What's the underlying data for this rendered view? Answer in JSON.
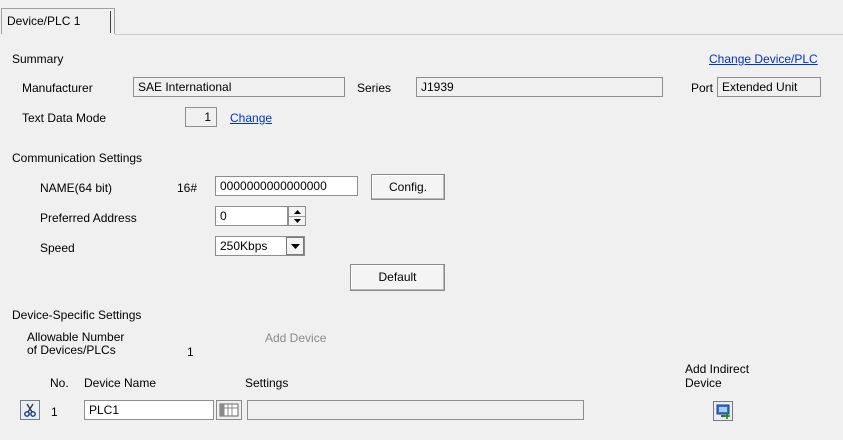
{
  "tab": {
    "label": "Device/PLC 1"
  },
  "summary": {
    "heading": "Summary",
    "change_device_link": "Change Device/PLC",
    "manufacturer_label": "Manufacturer",
    "manufacturer_value": "SAE International",
    "series_label": "Series",
    "series_value": "J1939",
    "port_label": "Port",
    "port_value": "Extended Unit",
    "text_data_mode_label": "Text Data Mode",
    "text_data_mode_value": "1",
    "change_link": "Change"
  },
  "comm": {
    "heading": "Communication Settings",
    "name_label": "NAME(64 bit)",
    "name_prefix": "16#",
    "name_value": "0000000000000000",
    "config_button": "Config.",
    "preferred_address_label": "Preferred Address",
    "preferred_address_value": "0",
    "speed_label": "Speed",
    "speed_value": "250Kbps",
    "default_button": "Default"
  },
  "device_specific": {
    "heading": "Device-Specific Settings",
    "allowable_line1": "Allowable Number",
    "allowable_line2": "of Devices/PLCs",
    "allowable_value": "1",
    "add_device": "Add Device",
    "add_indirect_line1": "Add Indirect",
    "add_indirect_line2": "Device",
    "col_no": "No.",
    "col_device_name": "Device Name",
    "col_settings": "Settings",
    "rows": [
      {
        "no": "1",
        "device_name": "PLC1",
        "settings": ""
      }
    ]
  },
  "icons": {
    "delete_row": "scissors-icon",
    "settings_button": "settings-grid-icon",
    "add_indirect": "add-indirect-device-icon"
  }
}
